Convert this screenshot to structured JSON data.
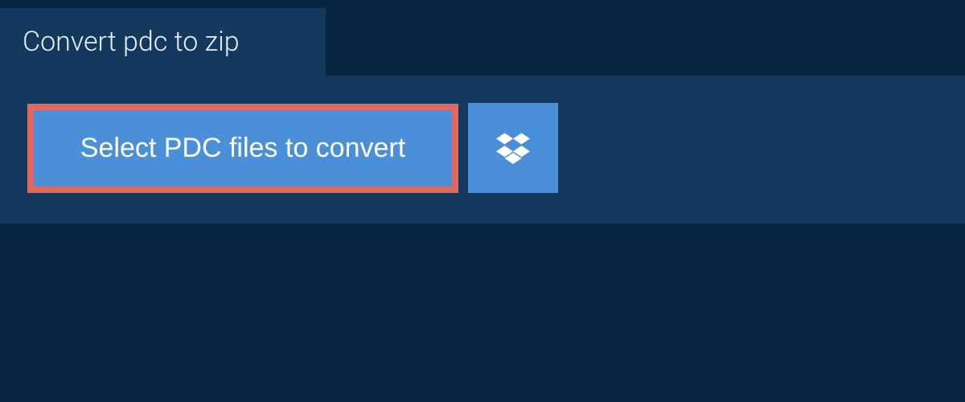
{
  "header": {
    "title": "Convert pdc to zip"
  },
  "actions": {
    "select_files_label": "Select PDC files to convert"
  },
  "colors": {
    "background": "#0a2540",
    "panel": "#14395f",
    "button": "#4a90d9",
    "highlight_border": "#e06a5f",
    "text_light": "#ffffff"
  },
  "icons": {
    "dropbox": "dropbox-icon"
  }
}
